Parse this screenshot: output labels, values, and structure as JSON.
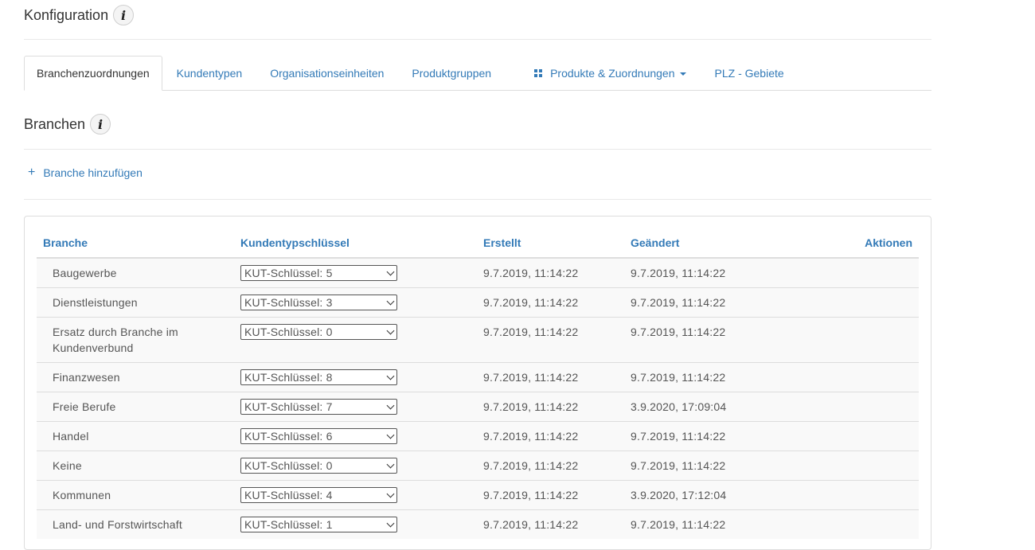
{
  "page": {
    "title": "Konfiguration",
    "section_title": "Branchen",
    "add_label": "Branche hinzufügen"
  },
  "tabs": [
    {
      "label": "Branchenzuordnungen",
      "active": true
    },
    {
      "label": "Kundentypen"
    },
    {
      "label": "Organisationseinheiten"
    },
    {
      "label": "Produktgruppen"
    },
    {
      "label": "Produkte & Zuordnungen",
      "icon": "grid-icon",
      "dropdown": true
    },
    {
      "label": "PLZ - Gebiete"
    }
  ],
  "table": {
    "headers": {
      "name": "Branche",
      "key": "Kundentypschlüssel",
      "created": "Erstellt",
      "changed": "Geändert",
      "actions": "Aktionen"
    },
    "rows": [
      {
        "name": "Baugewerbe",
        "key": "KUT-Schlüssel: 5",
        "created": "9.7.2019, 11:14:22",
        "changed": "9.7.2019, 11:14:22"
      },
      {
        "name": "Dienstleistungen",
        "key": "KUT-Schlüssel: 3",
        "created": "9.7.2019, 11:14:22",
        "changed": "9.7.2019, 11:14:22"
      },
      {
        "name": "Ersatz durch Branche im Kundenverbund",
        "key": "KUT-Schlüssel: 0",
        "created": "9.7.2019, 11:14:22",
        "changed": "9.7.2019, 11:14:22"
      },
      {
        "name": "Finanzwesen",
        "key": "KUT-Schlüssel: 8",
        "created": "9.7.2019, 11:14:22",
        "changed": "9.7.2019, 11:14:22"
      },
      {
        "name": "Freie Berufe",
        "key": "KUT-Schlüssel: 7",
        "created": "9.7.2019, 11:14:22",
        "changed": "3.9.2020, 17:09:04"
      },
      {
        "name": "Handel",
        "key": "KUT-Schlüssel: 6",
        "created": "9.7.2019, 11:14:22",
        "changed": "9.7.2019, 11:14:22"
      },
      {
        "name": "Keine",
        "key": "KUT-Schlüssel: 0",
        "created": "9.7.2019, 11:14:22",
        "changed": "9.7.2019, 11:14:22"
      },
      {
        "name": "Kommunen",
        "key": "KUT-Schlüssel: 4",
        "created": "9.7.2019, 11:14:22",
        "changed": "3.9.2020, 17:12:04"
      },
      {
        "name": "Land- und Forstwirtschaft",
        "key": "KUT-Schlüssel: 1",
        "created": "9.7.2019, 11:14:22",
        "changed": "9.7.2019, 11:14:22"
      }
    ]
  }
}
